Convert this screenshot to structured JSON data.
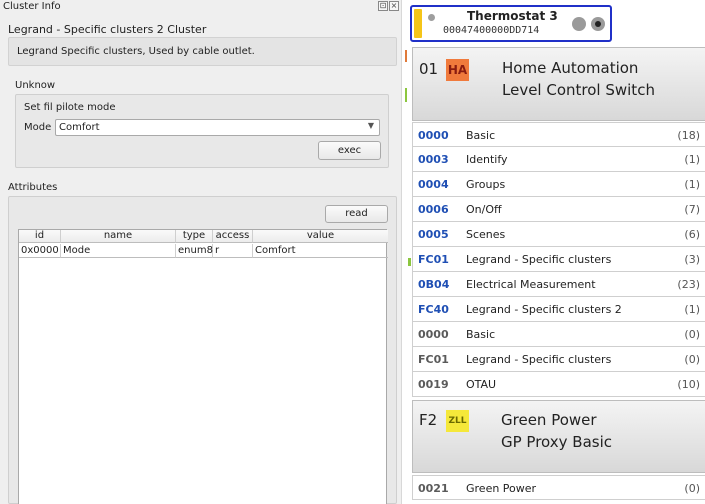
{
  "dock": {
    "title": "Cluster Info",
    "float_glyph": "⊡",
    "close_glyph": "×",
    "cluster_name": "Legrand - Specific clusters 2 Cluster",
    "cluster_description": "Legrand Specific clusters, Used by cable outlet.",
    "section_label": "Unknow",
    "command": {
      "title": "Set fil pilote mode",
      "mode_label": "Mode",
      "mode_value": "Comfort",
      "exec_label": "exec"
    },
    "attributes": {
      "label": "Attributes",
      "read_label": "read",
      "columns": [
        "id",
        "name",
        "type",
        "access",
        "value"
      ],
      "rows": [
        {
          "id": "0x0000",
          "name": "Mode",
          "type": "enum8",
          "access": "r",
          "value": "Comfort"
        }
      ]
    }
  },
  "node": {
    "name": "Thermostat 3",
    "mac": "00047400000DD714",
    "endpoints": [
      {
        "number": "01",
        "badge": "HA",
        "badge_color": "#f07a3c",
        "line1": "Home Automation",
        "line2": "Level Control Switch",
        "clusters": [
          {
            "id": "0000",
            "name": "Basic",
            "count": "(18)",
            "kind": "server"
          },
          {
            "id": "0003",
            "name": "Identify",
            "count": "(1)",
            "kind": "server"
          },
          {
            "id": "0004",
            "name": "Groups",
            "count": "(1)",
            "kind": "server"
          },
          {
            "id": "0006",
            "name": "On/Off",
            "count": "(7)",
            "kind": "server"
          },
          {
            "id": "0005",
            "name": "Scenes",
            "count": "(6)",
            "kind": "server"
          },
          {
            "id": "FC01",
            "name": "Legrand - Specific clusters",
            "count": "(3)",
            "kind": "server"
          },
          {
            "id": "0B04",
            "name": "Electrical Measurement",
            "count": "(23)",
            "kind": "server"
          },
          {
            "id": "FC40",
            "name": "Legrand - Specific clusters 2",
            "count": "(1)",
            "kind": "server"
          },
          {
            "id": "0000",
            "name": "Basic",
            "count": "(0)",
            "kind": "client"
          },
          {
            "id": "FC01",
            "name": "Legrand - Specific clusters",
            "count": "(0)",
            "kind": "client"
          },
          {
            "id": "0019",
            "name": "OTAU",
            "count": "(10)",
            "kind": "client"
          }
        ]
      },
      {
        "number": "F2",
        "badge": "ZLL",
        "badge_color": "#f5e83a",
        "line1": "Green Power",
        "line2": "GP Proxy Basic",
        "clusters": [
          {
            "id": "0021",
            "name": "Green Power",
            "count": "(0)",
            "kind": "client"
          }
        ]
      }
    ],
    "colors": {
      "server_id": "#1f4fb4",
      "client_id": "#5a5a5a",
      "node_border": "#2030c8",
      "node_stripe": "#f5c518"
    }
  }
}
